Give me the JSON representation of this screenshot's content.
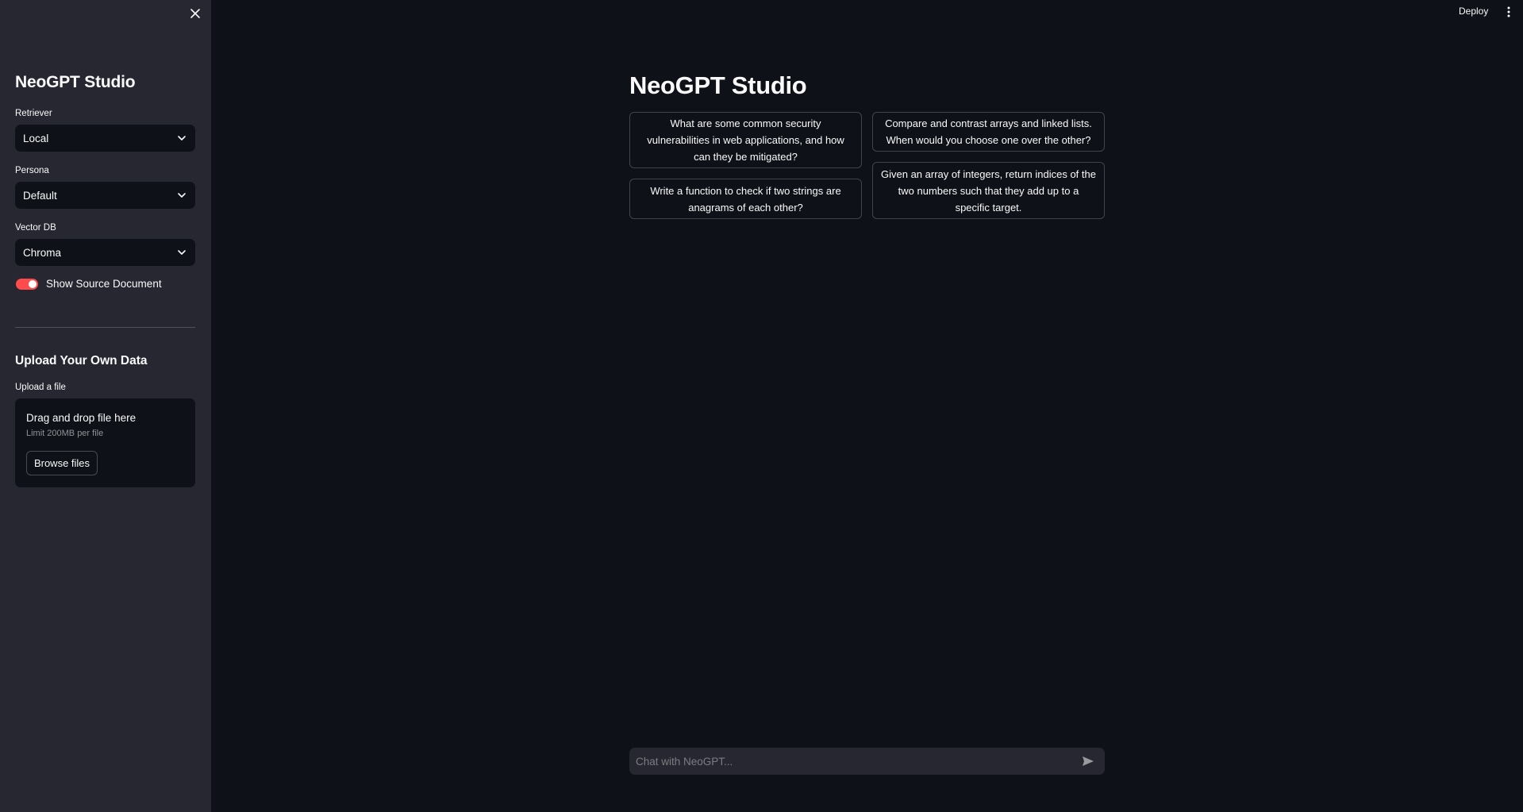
{
  "sidebar": {
    "title": "NeoGPT Studio",
    "retriever": {
      "label": "Retriever",
      "value": "Local"
    },
    "persona": {
      "label": "Persona",
      "value": "Default"
    },
    "vector_db": {
      "label": "Vector DB",
      "value": "Chroma"
    },
    "toggle": {
      "label": "Show Source Document",
      "on": true
    },
    "upload": {
      "section_title": "Upload Your Own Data",
      "label": "Upload a file",
      "drop_title": "Drag and drop file here",
      "limit": "Limit 200MB per file",
      "browse_label": "Browse files"
    }
  },
  "header": {
    "deploy_label": "Deploy"
  },
  "main": {
    "title": "NeoGPT Studio",
    "suggestions": [
      "What are some common security vulnerabilities in web applications, and how can they be mitigated?",
      "Compare and contrast arrays and linked lists. When would you choose one over the other?",
      "Write a function to check if two strings are anagrams of each other?",
      "Given an array of integers, return indices of the two numbers such that they add up to a specific target."
    ],
    "chat_placeholder": "Chat with NeoGPT..."
  },
  "colors": {
    "background": "#0e1117",
    "sidebar": "#262730",
    "accent": "#ff4b4b",
    "text": "#fafafa"
  },
  "icons": {
    "close": "close-icon",
    "chevron": "chevron-down-icon",
    "menu": "kebab-menu-icon",
    "send": "send-icon"
  }
}
